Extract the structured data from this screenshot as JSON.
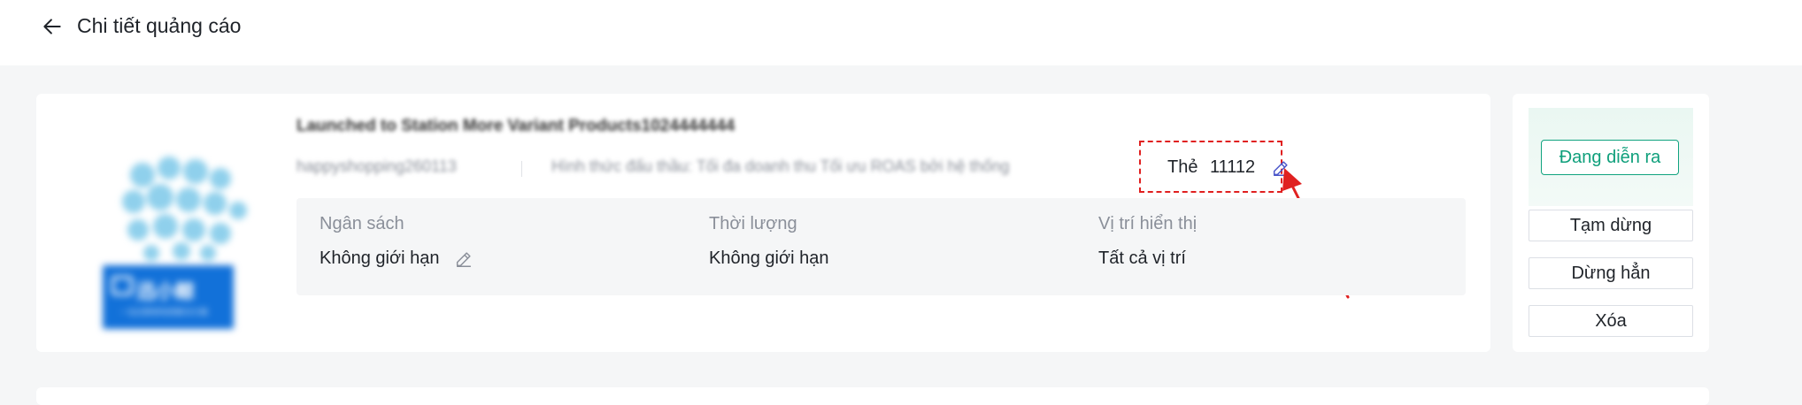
{
  "header": {
    "title": "Chi tiết quảng cáo"
  },
  "ad": {
    "title": "Launched to Station More Variant Products1024444444",
    "shop": "happyshopping260113",
    "bidding": "Hình thức đấu thầu: Tối đa doanh thu Tối ưu ROAS bởi hệ thống",
    "tag_label": "Thẻ",
    "tag_value": "11112",
    "thumbnail_text": "迅小鲸",
    "thumbnail_subtext": "一站式跨境电商解决方案"
  },
  "info": [
    {
      "label": "Ngân sách",
      "value": "Không giới hạn"
    },
    {
      "label": "Thời lượng",
      "value": "Không giới hạn"
    },
    {
      "label": "Vị trí hiển thị",
      "value": "Tất cả vị trí"
    }
  ],
  "status": {
    "label": "Đang diễn ra",
    "color": "#10a37f"
  },
  "actions": {
    "pause": "Tạm dừng",
    "stop": "Dừng hẳn",
    "delete": "Xóa"
  },
  "colors": {
    "highlight": "#e02020",
    "accent": "#4a55c9"
  }
}
